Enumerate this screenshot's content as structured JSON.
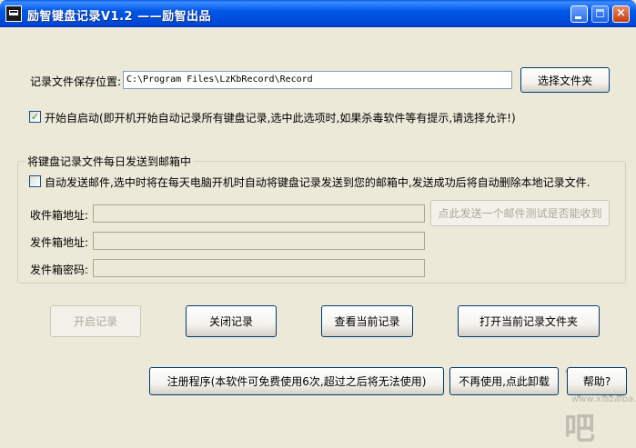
{
  "window": {
    "title": "励智键盘记录V1.2 ——励智出品",
    "minimize_glyph": "_",
    "maximize_glyph": "□",
    "close_glyph": "×"
  },
  "record_path": {
    "label": "记录文件保存位置:",
    "value": "C:\\Program Files\\LzKbRecord\\Record",
    "browse_button": "选择文件夹"
  },
  "autostart": {
    "checked": true,
    "check_glyph": "✓",
    "label": "开始自启动(即开机开始自动记录所有键盘记录,选中此选项时,如果杀毒软件等有提示,请选择允许!)"
  },
  "email_group": {
    "title": "将键盘记录文件每日发送到邮箱中",
    "auto_send": {
      "checked": false,
      "label": "自动发送邮件,选中时将在每天电脑开机时自动将键盘记录发送到您的邮箱中,发送成功后将自动删除本地记录文件."
    },
    "receiver_label": "收件箱地址:",
    "receiver_value": "",
    "sender_label": "发件箱地址:",
    "sender_value": "",
    "password_label": "发件箱密码:",
    "password_value": "",
    "test_button": "点此发送一个邮件测试是否能收到"
  },
  "actions": {
    "start": "开启记录",
    "stop": "关闭记录",
    "view": "查看当前记录",
    "open_folder": "打开当前记录文件夹"
  },
  "footer": {
    "register": "注册程序(本软件可免费使用6次,超过之后将无法使用)",
    "uninstall": "不再使用,点此卸载",
    "help": "帮助?"
  },
  "watermark": {
    "main": "下载吧",
    "sub": "www.xiazaiba.com"
  }
}
